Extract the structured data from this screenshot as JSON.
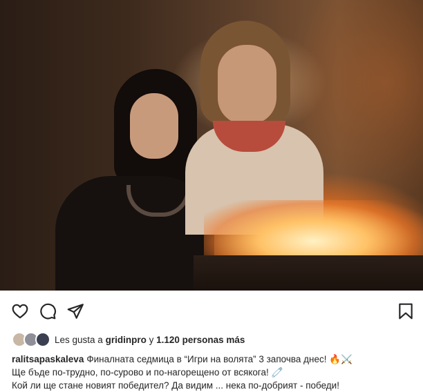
{
  "post": {
    "photo_alt": "Post photo",
    "likes": {
      "prefix": "Les gusta a",
      "user": "gridinpro",
      "middle": "y",
      "count": "1.120 personas más"
    },
    "caption": {
      "username": "ralitsapaskaleva",
      "line1": "Финалната седмица в “Игри на волята” 3 започва днес! 🔥⚔️",
      "line2": "Ще бъде по-трудно, по-сурово и по-нагорещено от всякога! 🧷",
      "line3": "Кой ли ще стане новият победител? Да видим ... нека по-добрият - победи!"
    }
  },
  "actions": {
    "like_icon": "heart-icon",
    "comment_icon": "comment-icon",
    "share_icon": "paper-plane-icon",
    "save_icon": "bookmark-icon"
  },
  "colors": {
    "text": "#262626",
    "background": "#ffffff"
  }
}
